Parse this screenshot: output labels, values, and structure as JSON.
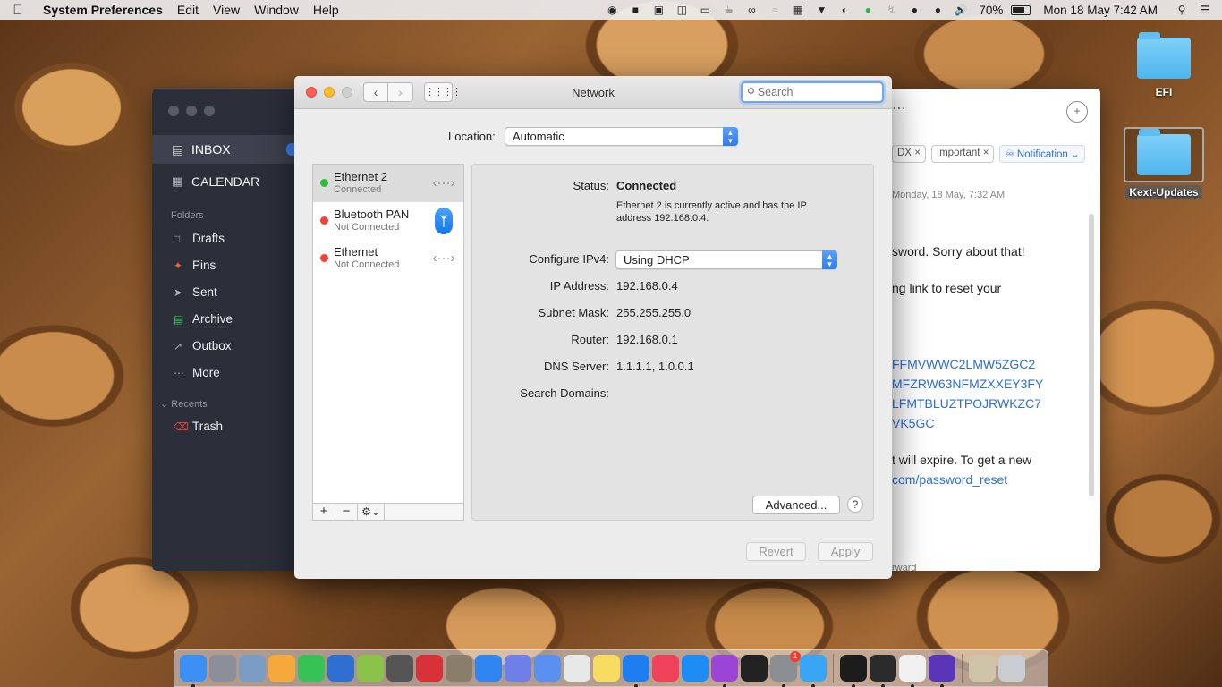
{
  "menubar": {
    "app_name": "System Preferences",
    "menus": [
      "Edit",
      "View",
      "Window",
      "Help"
    ],
    "battery_percent": "70%",
    "battery_level": 0.7,
    "datetime": "Mon 18 May  7:42 AM"
  },
  "desktop": {
    "icons": [
      {
        "label": "EFI"
      },
      {
        "label": "Kext-Updates"
      }
    ]
  },
  "mail": {
    "sidebar": {
      "inbox_label": "INBOX",
      "calendar_label": "CALENDAR",
      "folders_heading": "Folders",
      "folders": [
        "Drafts",
        "Pins",
        "Sent",
        "Archive",
        "Outbox",
        "More"
      ],
      "recents_heading": "Recents",
      "recents": [
        "Trash"
      ]
    },
    "tags": [
      "DX",
      "Important",
      "Notification"
    ],
    "date": "Monday, 18 May, 7:32 AM",
    "body_lines": [
      "sword. Sorry about that!",
      "ng link to reset your"
    ],
    "links": [
      "FFMVWWC2LMW5ZGC2",
      "MFZRW63NFMZXXEY3FY",
      "LFMTBLUZTPOJRWKZC7",
      "VK5GC"
    ],
    "expire_text": "t will expire. To get a new",
    "reset_link": "com/password_reset",
    "forward_label": "rward"
  },
  "network": {
    "window_title": "Network",
    "search_placeholder": "Search",
    "location_label": "Location:",
    "location_value": "Automatic",
    "services": [
      {
        "name": "Ethernet 2",
        "status": "Connected",
        "state": "green",
        "icon": "ethernet-icon",
        "selected": true
      },
      {
        "name": "Bluetooth PAN",
        "status": "Not Connected",
        "state": "red",
        "icon": "bluetooth-icon",
        "selected": false
      },
      {
        "name": "Ethernet",
        "status": "Not Connected",
        "state": "red",
        "icon": "ethernet-icon",
        "selected": false
      }
    ],
    "detail": {
      "status_label": "Status:",
      "status_value": "Connected",
      "status_desc": "Ethernet 2 is currently active and has the IP address 192.168.0.4.",
      "configure_label": "Configure IPv4:",
      "configure_value": "Using DHCP",
      "ip_label": "IP Address:",
      "ip_value": "192.168.0.4",
      "subnet_label": "Subnet Mask:",
      "subnet_value": "255.255.255.0",
      "router_label": "Router:",
      "router_value": "192.168.0.1",
      "dns_label": "DNS Server:",
      "dns_value": "1.1.1.1, 1.0.0.1",
      "search_domains_label": "Search Domains:",
      "search_domains_value": ""
    },
    "advanced_label": "Advanced...",
    "help_label": "?",
    "revert_label": "Revert",
    "apply_label": "Apply"
  },
  "dock": {
    "apps": [
      {
        "name": "finder",
        "color": "#3c8ff5"
      },
      {
        "name": "launchpad",
        "color": "#8a8f99"
      },
      {
        "name": "preview",
        "color": "#7b9cc4"
      },
      {
        "name": "photos",
        "color": "#f4a93a"
      },
      {
        "name": "facetime",
        "color": "#36c255"
      },
      {
        "name": "quicktime",
        "color": "#2f6fd1"
      },
      {
        "name": "vectorize",
        "color": "#8bc34a"
      },
      {
        "name": "final-cut",
        "color": "#555"
      },
      {
        "name": "music-maker",
        "color": "#d8313a"
      },
      {
        "name": "gimp",
        "color": "#8a7d6a"
      },
      {
        "name": "safari",
        "color": "#2f86f0"
      },
      {
        "name": "discord",
        "color": "#6f7fe8"
      },
      {
        "name": "drop",
        "color": "#5b8ff0"
      },
      {
        "name": "reminders",
        "color": "#e8e8e8"
      },
      {
        "name": "notes",
        "color": "#f7dc61"
      },
      {
        "name": "spark",
        "color": "#1e7ef0"
      },
      {
        "name": "music",
        "color": "#f0435a"
      },
      {
        "name": "app-store",
        "color": "#1d8cf5"
      },
      {
        "name": "podcasts",
        "color": "#9b45d6"
      },
      {
        "name": "apple-tv",
        "color": "#222"
      },
      {
        "name": "system-preferences",
        "color": "#8a8d92",
        "badge": "1"
      },
      {
        "name": "messages",
        "color": "#39a6f3"
      },
      {
        "name": "terminal",
        "color": "#1c1c1c"
      },
      {
        "name": "activity-monitor",
        "color": "#2b2b2b"
      },
      {
        "name": "java",
        "color": "#f0f0f0"
      },
      {
        "name": "brave",
        "color": "#5b35b8"
      },
      {
        "name": "archive-utility",
        "color": "#d0c4a8"
      },
      {
        "name": "trash",
        "color": "#c9ccd1"
      }
    ]
  }
}
